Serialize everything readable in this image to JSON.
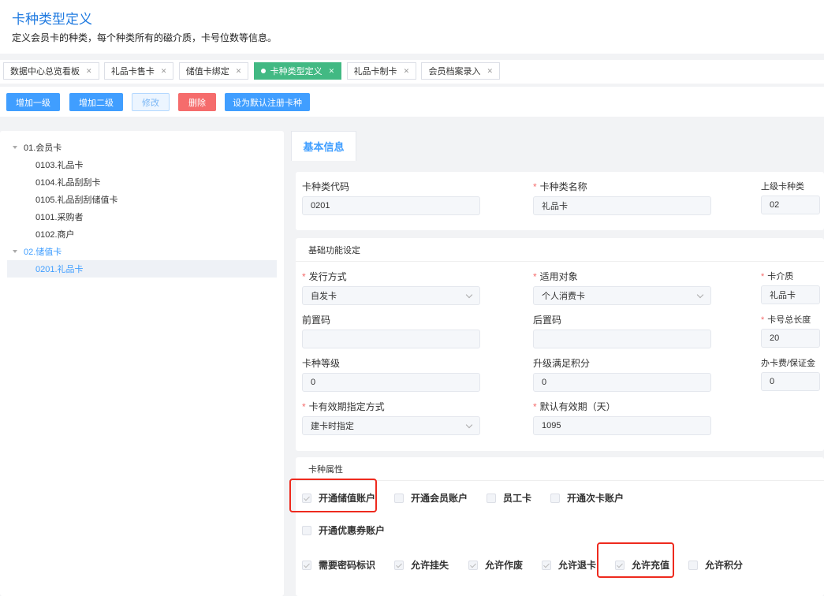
{
  "header": {
    "title": "卡种类型定义",
    "subtitle": "定义会员卡的种类，每个种类所有的磁介质，卡号位数等信息。"
  },
  "tabs": [
    {
      "label": "数据中心总览看板"
    },
    {
      "label": "礼品卡售卡"
    },
    {
      "label": "储值卡绑定"
    },
    {
      "label": "卡种类型定义",
      "active": true
    },
    {
      "label": "礼品卡制卡"
    },
    {
      "label": "会员档案录入"
    }
  ],
  "toolbar": {
    "add_level1": "增加一级",
    "add_level2": "增加二级",
    "edit": "修改",
    "delete": "删除",
    "set_default": "设为默认注册卡种"
  },
  "tree": [
    {
      "label": "01.会员卡",
      "children": [
        "0103.礼品卡",
        "0104.礼品刮刮卡",
        "0105.礼品刮刮储值卡",
        "0101.采购者",
        "0102.商户"
      ]
    },
    {
      "label": "02.储值卡",
      "children": [
        "0201.礼品卡"
      ]
    }
  ],
  "detail_tab": "基本信息",
  "basic": {
    "code_label": "卡种类代码",
    "code": "0201",
    "name_label": "卡种类名称",
    "name": "礼品卡",
    "parent_label": "上级卡种类",
    "parent": "02"
  },
  "func": {
    "title": "基础功能设定",
    "issue_label": "发行方式",
    "issue": "自发卡",
    "target_label": "适用对象",
    "target": "个人消费卡",
    "medium_label": "卡介质",
    "medium": "礼品卡",
    "prefix_label": "前置码",
    "prefix": "",
    "suffix_label": "后置码",
    "suffix": "",
    "length_label": "卡号总长度",
    "length": "20",
    "grade_label": "卡种等级",
    "grade": "0",
    "upgrade_label": "升级满足积分",
    "upgrade": "0",
    "fee_label": "办卡费/保证金",
    "fee": "0",
    "validity_mode_label": "卡有效期指定方式",
    "validity_mode": "建卡时指定",
    "validity_days_label": "默认有效期（天）",
    "validity_days": "1095"
  },
  "attrs": {
    "title": "卡种属性",
    "items": [
      {
        "label": "开通储值账户",
        "checked": true
      },
      {
        "label": "开通会员账户",
        "checked": false
      },
      {
        "label": "员工卡",
        "checked": false
      },
      {
        "label": "开通次卡账户",
        "checked": false
      },
      {
        "label": "开通优惠券账户",
        "checked": false
      },
      {
        "label": "需要密码标识",
        "checked": true
      },
      {
        "label": "允许挂失",
        "checked": true
      },
      {
        "label": "允许作废",
        "checked": true
      },
      {
        "label": "允许退卡",
        "checked": true
      },
      {
        "label": "允许充值",
        "checked": true
      },
      {
        "label": "允许积分",
        "checked": false
      }
    ]
  }
}
